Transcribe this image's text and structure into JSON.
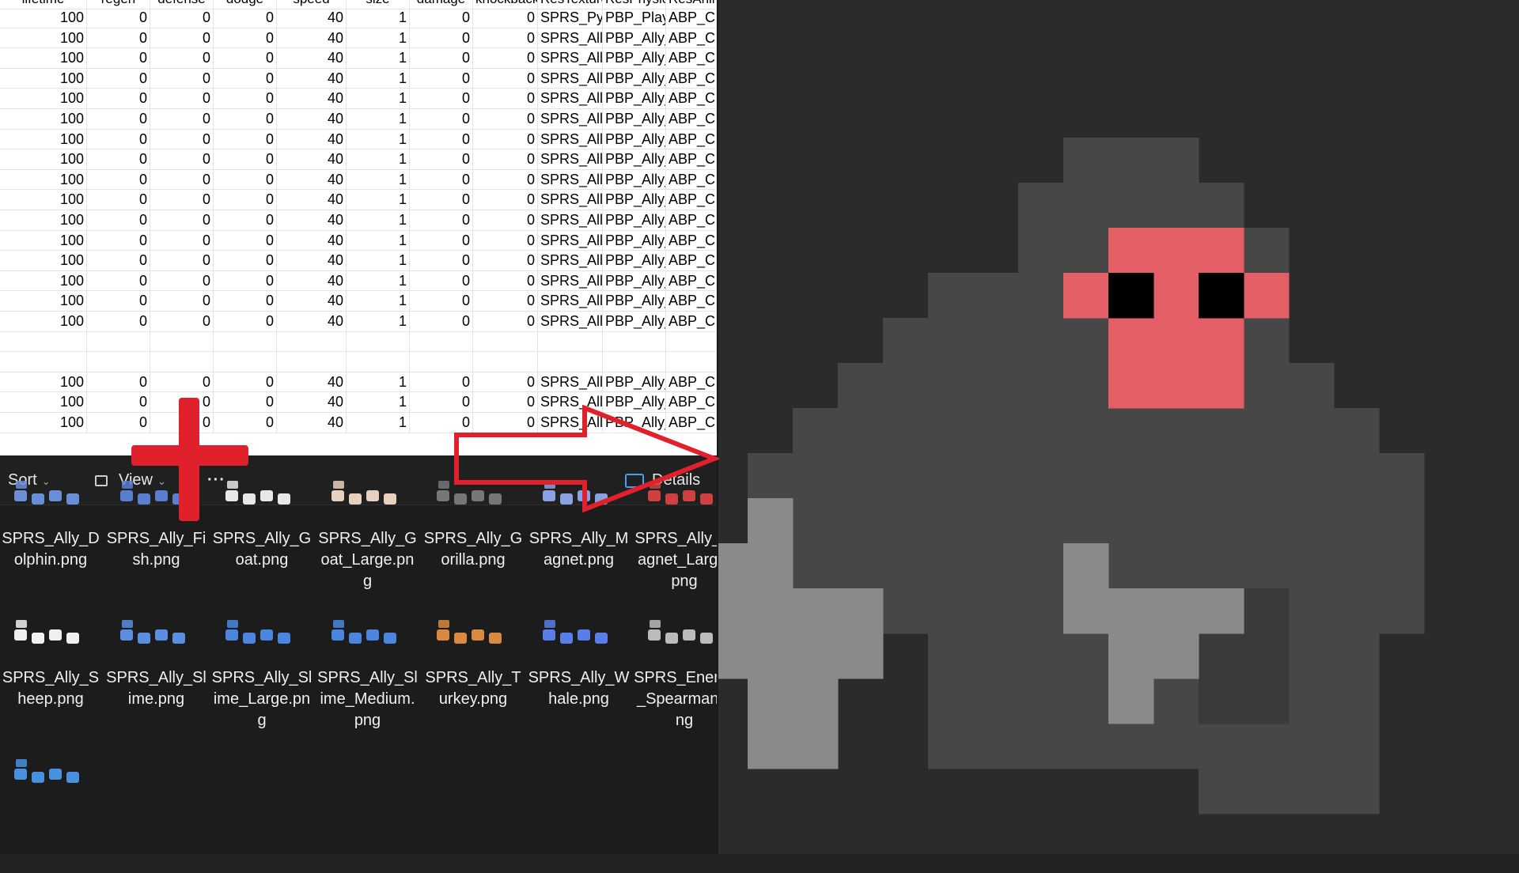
{
  "spreadsheet": {
    "headers": [
      "lifetime",
      "regen",
      "defense",
      "dodge",
      "speed",
      "size",
      "damage",
      "knockback",
      "ResTexture",
      "ResPhysics",
      "ResAnim"
    ],
    "rows": [
      [
        "100",
        "0",
        "0",
        "0",
        "40",
        "1",
        "0",
        "0",
        "SPRS_Pyo",
        "PBP_Player",
        "ABP_Ch"
      ],
      [
        "100",
        "0",
        "0",
        "0",
        "40",
        "1",
        "0",
        "0",
        "SPRS_Ally",
        "PBP_Ally_",
        "ABP_Ch"
      ],
      [
        "100",
        "0",
        "0",
        "0",
        "40",
        "1",
        "0",
        "0",
        "SPRS_Ally",
        "PBP_Ally_",
        "ABP_Ch"
      ],
      [
        "100",
        "0",
        "0",
        "0",
        "40",
        "1",
        "0",
        "0",
        "SPRS_Ally",
        "PBP_Ally_",
        "ABP_Ch"
      ],
      [
        "100",
        "0",
        "0",
        "0",
        "40",
        "1",
        "0",
        "0",
        "SPRS_Ally",
        "PBP_Ally_",
        "ABP_Ch"
      ],
      [
        "100",
        "0",
        "0",
        "0",
        "40",
        "1",
        "0",
        "0",
        "SPRS_Ally",
        "PBP_Ally_",
        "ABP_Ch"
      ],
      [
        "100",
        "0",
        "0",
        "0",
        "40",
        "1",
        "0",
        "0",
        "SPRS_Ally",
        "PBP_Ally_",
        "ABP_Ch"
      ],
      [
        "100",
        "0",
        "0",
        "0",
        "40",
        "1",
        "0",
        "0",
        "SPRS_Ally",
        "PBP_Ally_",
        "ABP_Ch"
      ],
      [
        "100",
        "0",
        "0",
        "0",
        "40",
        "1",
        "0",
        "0",
        "SPRS_Ally",
        "PBP_Ally_",
        "ABP_Ch"
      ],
      [
        "100",
        "0",
        "0",
        "0",
        "40",
        "1",
        "0",
        "0",
        "SPRS_Ally",
        "PBP_Ally_",
        "ABP_Ch"
      ],
      [
        "100",
        "0",
        "0",
        "0",
        "40",
        "1",
        "0",
        "0",
        "SPRS_Ally",
        "PBP_Ally_",
        "ABP_Ch"
      ],
      [
        "100",
        "0",
        "0",
        "0",
        "40",
        "1",
        "0",
        "0",
        "SPRS_Ally",
        "PBP_Ally_",
        "ABP_Ch"
      ],
      [
        "100",
        "0",
        "0",
        "0",
        "40",
        "1",
        "0",
        "0",
        "SPRS_Ally",
        "PBP_Ally_",
        "ABP_Ch"
      ],
      [
        "100",
        "0",
        "0",
        "0",
        "40",
        "1",
        "0",
        "0",
        "SPRS_Ally",
        "PBP_Ally_",
        "ABP_Ch"
      ],
      [
        "100",
        "0",
        "0",
        "0",
        "40",
        "1",
        "0",
        "0",
        "SPRS_Ally",
        "PBP_Ally_",
        "ABP_Ch"
      ],
      [
        "100",
        "0",
        "0",
        "0",
        "40",
        "1",
        "0",
        "0",
        "SPRS_Ally",
        "PBP_Ally_",
        "ABP_Ch"
      ],
      [
        "",
        "",
        "",
        "",
        "",
        "",
        "",
        "",
        "",
        "",
        ""
      ],
      [
        "",
        "",
        "",
        "",
        "",
        "",
        "",
        "",
        "",
        "",
        ""
      ],
      [
        "100",
        "0",
        "0",
        "0",
        "40",
        "1",
        "0",
        "0",
        "SPRS_Ally",
        "PBP_Ally_",
        "ABP_Ch"
      ],
      [
        "100",
        "0",
        "0",
        "0",
        "40",
        "1",
        "0",
        "0",
        "SPRS_Ally",
        "PBP_Ally_",
        "ABP_Ch"
      ],
      [
        "100",
        "0",
        "0",
        "0",
        "40",
        "1",
        "0",
        "0",
        "SPRS_Ally",
        "PBP_Ally_",
        "ABP_Ch"
      ]
    ]
  },
  "explorer": {
    "toolbar": {
      "sort_label": "Sort",
      "view_label": "View",
      "more_label": "···",
      "details_label": "Details"
    },
    "files": [
      {
        "name": "SPRS_Ally_Dolphin.png",
        "color": "#6a8fd8"
      },
      {
        "name": "SPRS_Ally_Fish.png",
        "color": "#5a7fd0"
      },
      {
        "name": "SPRS_Ally_Goat.png",
        "color": "#e8e8e8"
      },
      {
        "name": "SPRS_Ally_Goat_Large.png",
        "color": "#e8d0c0"
      },
      {
        "name": "SPRS_Ally_Gorilla.png",
        "color": "#777777"
      },
      {
        "name": "SPRS_Ally_Magnet.png",
        "color": "#8aa0e0"
      },
      {
        "name": "SPRS_Ally_Magnet_Large.png",
        "color": "#d04040"
      },
      {
        "name": "SPRS_Ally_Sheep.png",
        "color": "#f0f0f0"
      },
      {
        "name": "SPRS_Ally_Slime.png",
        "color": "#5a8ee0"
      },
      {
        "name": "SPRS_Ally_Slime_Large.png",
        "color": "#4a86e0"
      },
      {
        "name": "SPRS_Ally_Slime_Medium.png",
        "color": "#4a86e0"
      },
      {
        "name": "SPRS_Ally_Turkey.png",
        "color": "#d88a40"
      },
      {
        "name": "SPRS_Ally_Whale.png",
        "color": "#5a7ee8"
      },
      {
        "name": "SPRS_Enemy_Spearman.png",
        "color": "#bbbbbb"
      },
      {
        "name": "",
        "color": "#4a90e0"
      }
    ]
  },
  "colors": {
    "sprite_face": "#e45e66",
    "sprite_body": "#474747",
    "sprite_dark": "#3a3a3a",
    "sprite_light": "#8a8a8a",
    "sprite_eye": "#000000",
    "annotation": "#e0202a"
  }
}
